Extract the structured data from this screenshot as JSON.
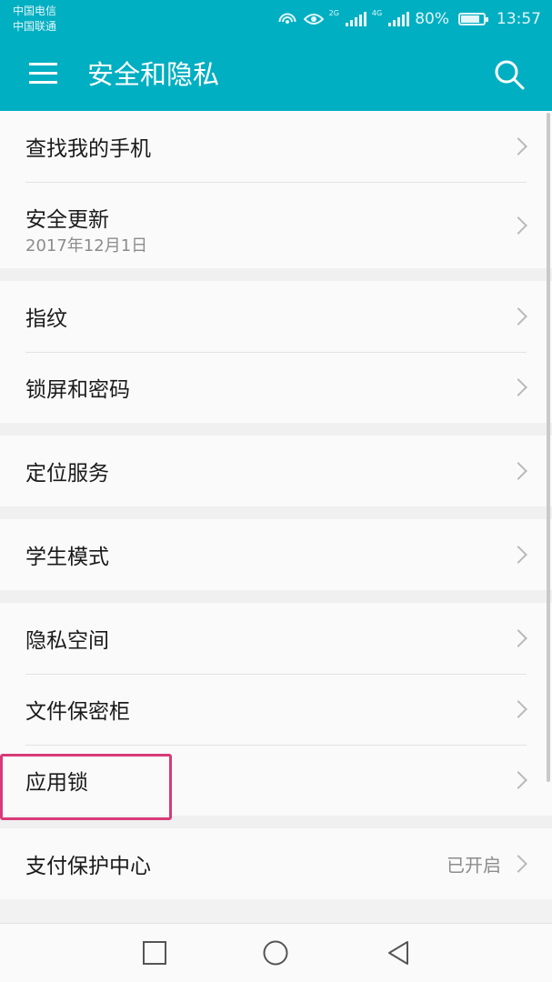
{
  "status_bar": {
    "carrier_1": "中国电信",
    "carrier_2": "中国联通",
    "battery_level": "80%",
    "time": "13:57",
    "network_1": "2G",
    "network_2": "4G"
  },
  "app_bar": {
    "title": "安全和隐私",
    "menu_icon": "hamburger-menu-icon",
    "search_icon": "search-icon"
  },
  "settings_groups": [
    [
      {
        "title": "查找我的手机"
      },
      {
        "title": "安全更新",
        "subtitle": "2017年12月1日"
      }
    ],
    [
      {
        "title": "指纹"
      },
      {
        "title": "锁屏和密码"
      }
    ],
    [
      {
        "title": "定位服务"
      }
    ],
    [
      {
        "title": "学生模式"
      }
    ],
    [
      {
        "title": "隐私空间"
      },
      {
        "title": "文件保密柜"
      },
      {
        "title": "应用锁"
      }
    ],
    [
      {
        "title": "支付保护中心",
        "value": "已开启"
      }
    ]
  ],
  "colors": {
    "header_background": "#01afc2",
    "highlight_border": "#d93a78"
  },
  "nav_bar": {
    "icons": [
      "back-triangle-icon",
      "home-circle-icon",
      "recents-square-icon"
    ]
  }
}
